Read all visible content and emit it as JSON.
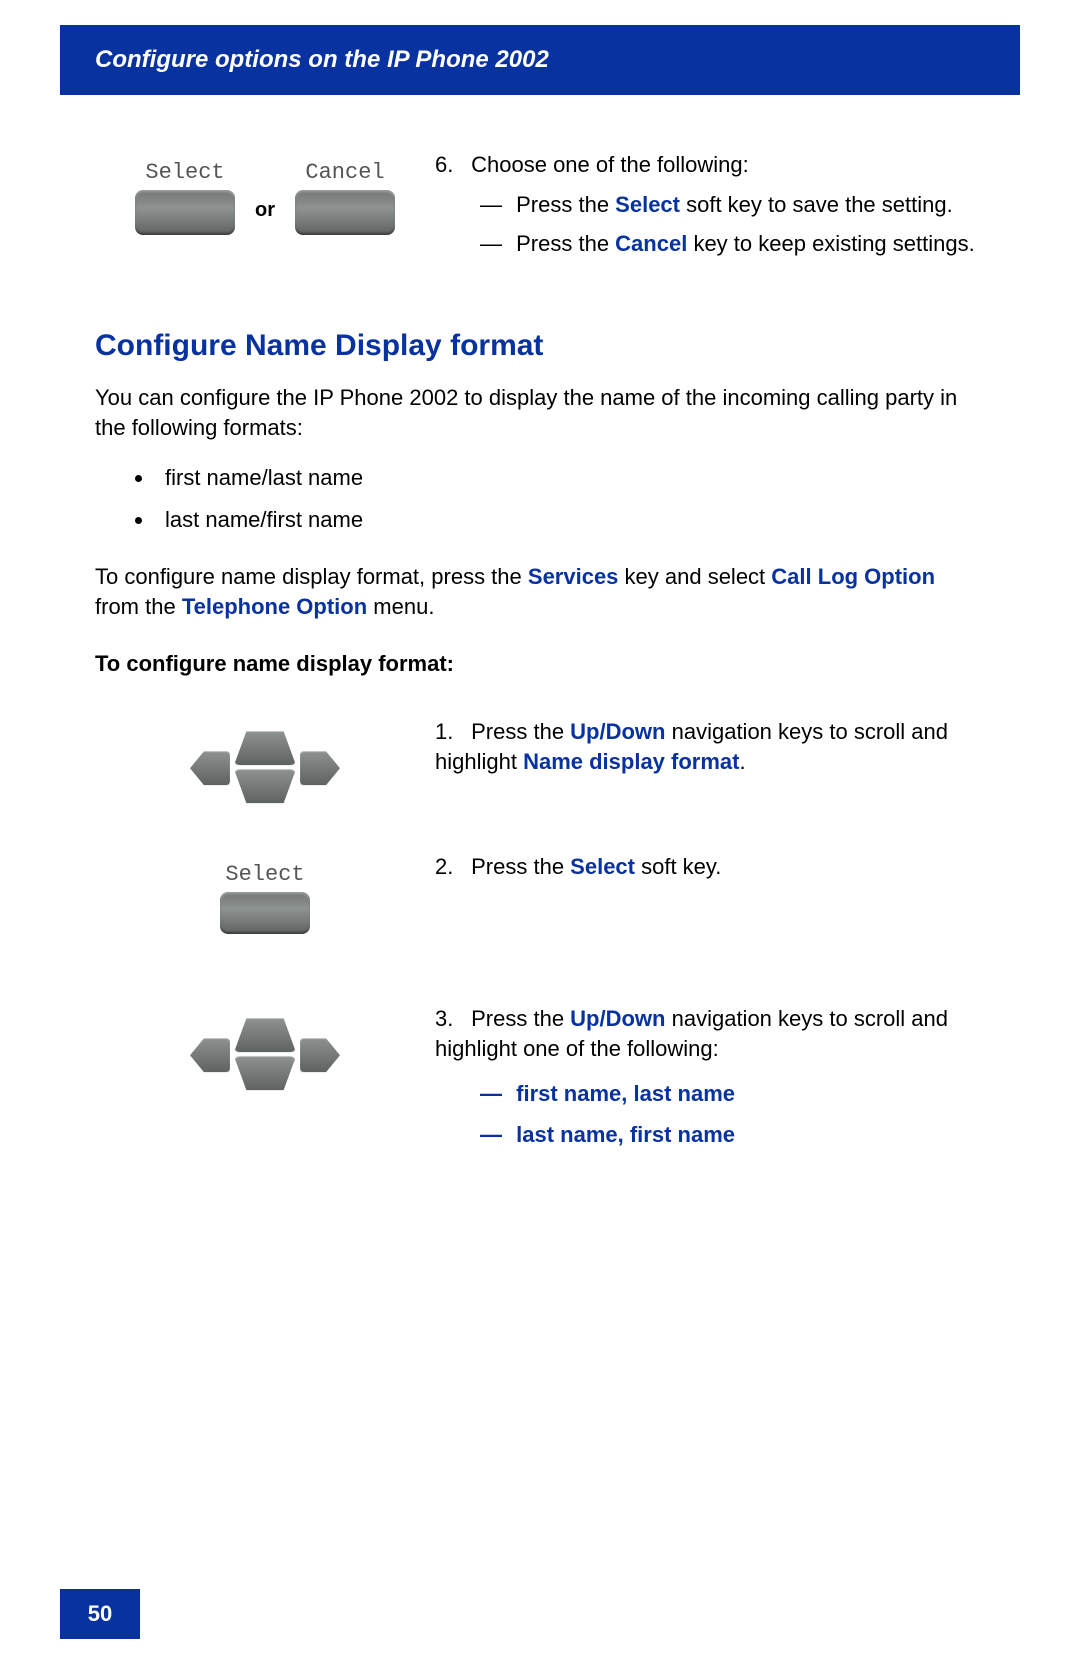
{
  "header": {
    "title": "Configure options on the IP Phone 2002"
  },
  "top_step": {
    "or": "or",
    "key_select": "Select",
    "key_cancel": "Cancel",
    "num": "6.",
    "lead": "Choose one of the following:",
    "sub1_pre": "Press the ",
    "sub1_kw": "Select",
    "sub1_post": " soft key to save the setting.",
    "sub2_pre": "Press the ",
    "sub2_kw": "Cancel",
    "sub2_post": " key to keep existing settings."
  },
  "section": {
    "heading": "Configure Name Display format",
    "para1": "You can configure the IP Phone 2002 to display the name of the incoming calling party in the following formats:",
    "bullets": [
      "first name/last name",
      "last name/first name"
    ],
    "para2_pre": "To configure name display format, press the ",
    "para2_kw1": "Services",
    "para2_mid": " key and select ",
    "para2_kw2": "Call Log Option",
    "para2_mid2": " from the ",
    "para2_kw3": "Telephone Option",
    "para2_post": " menu.",
    "lead": "To configure name display format:"
  },
  "steps": {
    "s1": {
      "num": "1.",
      "pre": "Press the ",
      "kw1": "Up/Down",
      "mid": " navigation keys to scroll and highlight ",
      "kw2": "Name display format",
      "post": "."
    },
    "s2": {
      "label": "Select",
      "num": "2.",
      "pre": "Press the ",
      "kw": "Select",
      "post": " soft key."
    },
    "s3": {
      "num": "3.",
      "pre": "Press the ",
      "kw": "Up/Down",
      "post": " navigation keys to scroll and highlight one of the following:",
      "opt1": "first name, last name",
      "opt2": "last name, first name"
    }
  },
  "footer": {
    "page": "50"
  },
  "dash": "—"
}
